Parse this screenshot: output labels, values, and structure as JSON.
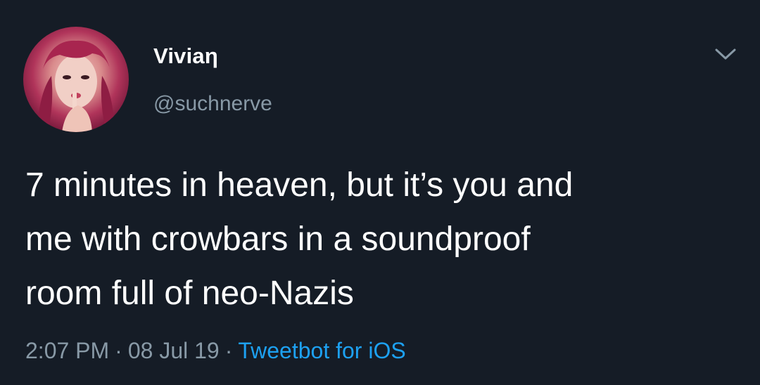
{
  "author": {
    "display_name": "Viviaη",
    "handle": "@suchnerve"
  },
  "tweet": {
    "text_lines": [
      "7 minutes in heaven, but it’s you and",
      "me with crowbars in a soundproof",
      "room full of neo-Nazis"
    ],
    "time": "2:07 PM",
    "date": "08 Jul 19",
    "separator": "·",
    "client": "Tweetbot for iOS"
  },
  "icons": {
    "menu": "chevron-down-icon",
    "avatar": "avatar"
  },
  "colors": {
    "background": "#151c26",
    "primary_text": "#ffffff",
    "secondary_text": "#8899a6",
    "link": "#1da1f2"
  }
}
